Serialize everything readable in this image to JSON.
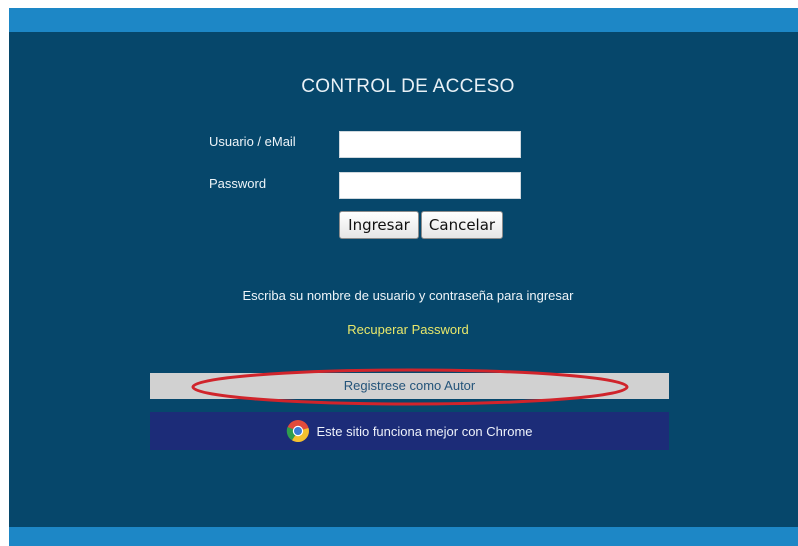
{
  "title": "CONTROL DE ACCESO",
  "form": {
    "user_label": "Usuario / eMail",
    "password_label": "Password",
    "user_value": "",
    "password_value": "",
    "login_button": "Ingresar",
    "cancel_button": "Cancelar"
  },
  "instructions": "Escriba su nombre de usuario y contraseña para ingresar",
  "recover_link": "Recuperar Password",
  "register_link": "Registrese como Autor",
  "chrome_notice": "Este sitio funciona mejor con Chrome",
  "chrome_icon": "chrome-icon",
  "colors": {
    "panel": "#06476b",
    "top_bar": "#1d87c6",
    "link_yellow": "#e9e86a",
    "register_bar": "#d1d1d1",
    "chrome_bar": "#1c2c78",
    "highlight": "#d0242b"
  }
}
